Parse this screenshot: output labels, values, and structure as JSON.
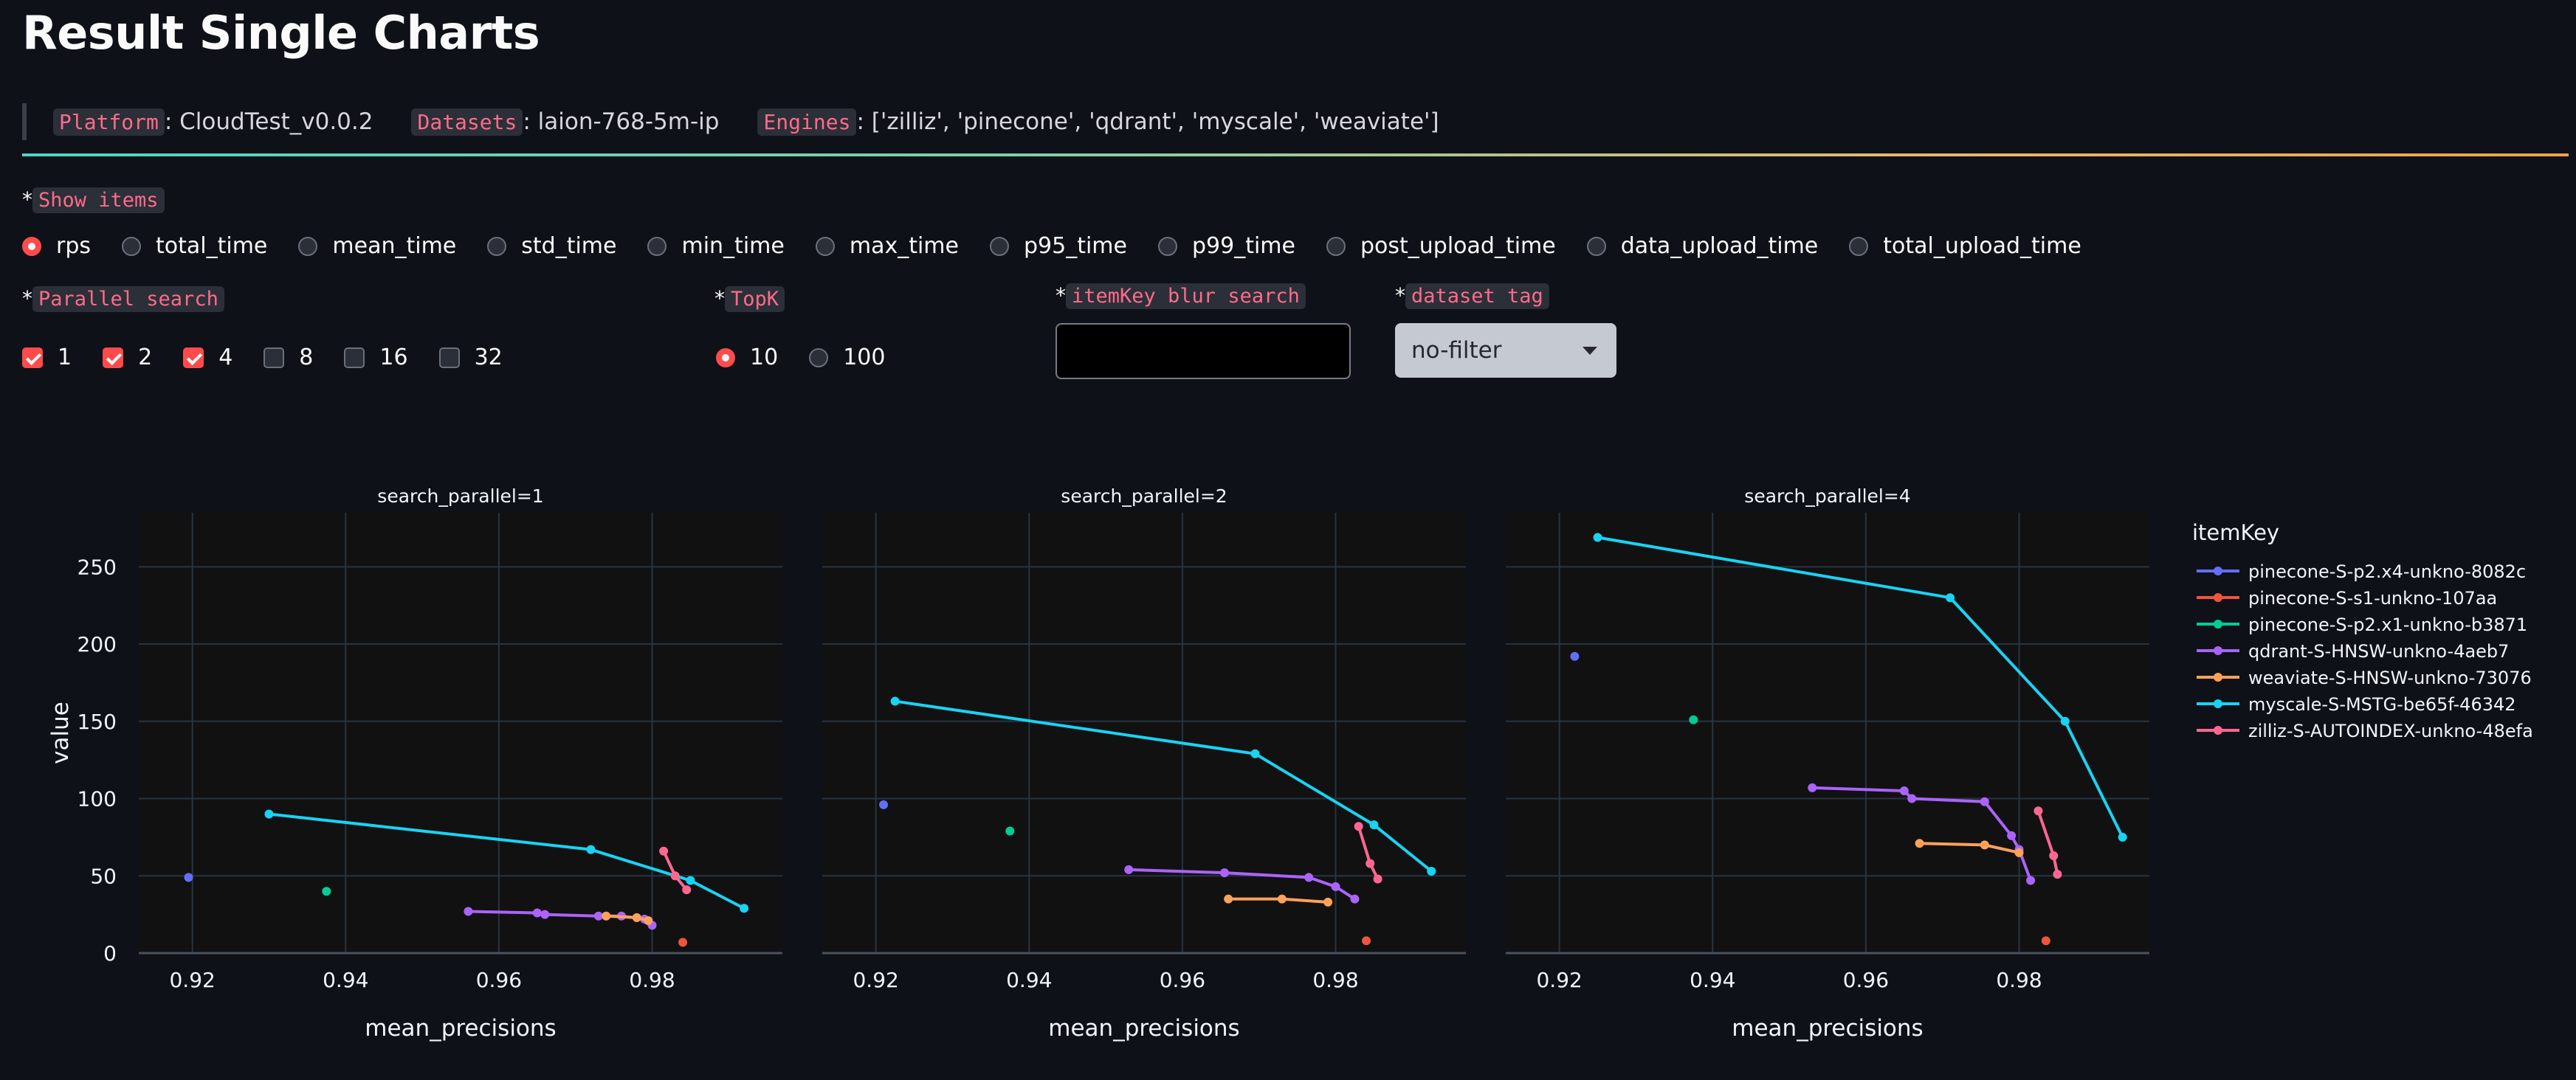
{
  "page": {
    "title": "Result Single Charts"
  },
  "info": {
    "platform_key": "Platform",
    "platform_value": ": CloudTest_v0.0.2",
    "datasets_key": "Datasets",
    "datasets_value": ": laion-768-5m-ip",
    "engines_key": "Engines",
    "engines_value": ": ['zilliz', 'pinecone', 'qdrant', 'myscale', 'weaviate']"
  },
  "show_items": {
    "label": "Show items",
    "options": [
      "rps",
      "total_time",
      "mean_time",
      "std_time",
      "min_time",
      "max_time",
      "p95_time",
      "p99_time",
      "post_upload_time",
      "data_upload_time",
      "total_upload_time"
    ],
    "selected": "rps"
  },
  "parallel_search": {
    "label": "Parallel search",
    "options": [
      {
        "label": "1",
        "checked": true
      },
      {
        "label": "2",
        "checked": true
      },
      {
        "label": "4",
        "checked": true
      },
      {
        "label": "8",
        "checked": false
      },
      {
        "label": "16",
        "checked": false
      },
      {
        "label": "32",
        "checked": false
      }
    ]
  },
  "topk": {
    "label": "TopK",
    "options": [
      "10",
      "100"
    ],
    "selected": "10"
  },
  "itemkey_search": {
    "label": "itemKey blur search",
    "value": ""
  },
  "dataset_tag": {
    "label": "dataset tag",
    "selected": "no-filter"
  },
  "colors": {
    "plot_bg": "#111111",
    "grid": "#283442",
    "series": [
      "#636efa",
      "#ef553b",
      "#00cc96",
      "#ab63fa",
      "#ffa15a",
      "#19d3f3",
      "#ff6692"
    ]
  },
  "chart_data": {
    "type": "line",
    "xlabel": "mean_precisions",
    "ylabel": "value",
    "xlim": [
      0.913,
      0.997
    ],
    "ylim": [
      0,
      285
    ],
    "xticks": [
      "0.92",
      "0.94",
      "0.96",
      "0.98"
    ],
    "yticks": [
      "0",
      "50",
      "100",
      "150",
      "200",
      "250"
    ],
    "legend_title": "itemKey",
    "legend_position": "right",
    "grid": true,
    "facets": [
      {
        "title": "search_parallel=1",
        "series": [
          {
            "name": "pinecone-S-p2.x4-unkno-8082c",
            "points": [
              [
                0.9195,
                49
              ]
            ]
          },
          {
            "name": "pinecone-S-s1-unkno-107aa",
            "points": [
              [
                0.984,
                7
              ]
            ]
          },
          {
            "name": "pinecone-S-p2.x1-unkno-b3871",
            "points": [
              [
                0.9375,
                40
              ]
            ]
          },
          {
            "name": "qdrant-S-HNSW-unkno-4aeb7",
            "points": [
              [
                0.956,
                27
              ],
              [
                0.965,
                26
              ],
              [
                0.966,
                25
              ],
              [
                0.973,
                24
              ],
              [
                0.976,
                24
              ],
              [
                0.979,
                22
              ],
              [
                0.98,
                18
              ]
            ]
          },
          {
            "name": "weaviate-S-HNSW-unkno-73076",
            "points": [
              [
                0.974,
                24
              ],
              [
                0.978,
                23
              ],
              [
                0.9795,
                21
              ]
            ]
          },
          {
            "name": "myscale-S-MSTG-be65f-46342",
            "points": [
              [
                0.93,
                90
              ],
              [
                0.972,
                67
              ],
              [
                0.985,
                47
              ],
              [
                0.992,
                29
              ]
            ]
          },
          {
            "name": "zilliz-S-AUTOINDEX-unkno-48efa",
            "points": [
              [
                0.9815,
                66
              ],
              [
                0.983,
                50
              ],
              [
                0.9845,
                41
              ]
            ]
          }
        ]
      },
      {
        "title": "search_parallel=2",
        "series": [
          {
            "name": "pinecone-S-p2.x4-unkno-8082c",
            "points": [
              [
                0.921,
                96
              ]
            ]
          },
          {
            "name": "pinecone-S-s1-unkno-107aa",
            "points": [
              [
                0.984,
                8
              ]
            ]
          },
          {
            "name": "pinecone-S-p2.x1-unkno-b3871",
            "points": [
              [
                0.9375,
                79
              ]
            ]
          },
          {
            "name": "qdrant-S-HNSW-unkno-4aeb7",
            "points": [
              [
                0.953,
                54
              ],
              [
                0.9655,
                52
              ],
              [
                0.9765,
                49
              ],
              [
                0.98,
                43
              ],
              [
                0.9825,
                35
              ]
            ]
          },
          {
            "name": "weaviate-S-HNSW-unkno-73076",
            "points": [
              [
                0.966,
                35
              ],
              [
                0.973,
                35
              ],
              [
                0.979,
                33
              ]
            ]
          },
          {
            "name": "myscale-S-MSTG-be65f-46342",
            "points": [
              [
                0.9225,
                163
              ],
              [
                0.9695,
                129
              ],
              [
                0.985,
                83
              ],
              [
                0.9925,
                53
              ]
            ]
          },
          {
            "name": "zilliz-S-AUTOINDEX-unkno-48efa",
            "points": [
              [
                0.983,
                82
              ],
              [
                0.9845,
                58
              ],
              [
                0.9855,
                48
              ]
            ]
          }
        ]
      },
      {
        "title": "search_parallel=4",
        "series": [
          {
            "name": "pinecone-S-p2.x4-unkno-8082c",
            "points": [
              [
                0.922,
                192
              ]
            ]
          },
          {
            "name": "pinecone-S-s1-unkno-107aa",
            "points": [
              [
                0.9835,
                8
              ]
            ]
          },
          {
            "name": "pinecone-S-p2.x1-unkno-b3871",
            "points": [
              [
                0.9375,
                151
              ]
            ]
          },
          {
            "name": "qdrant-S-HNSW-unkno-4aeb7",
            "points": [
              [
                0.953,
                107
              ],
              [
                0.965,
                105
              ],
              [
                0.966,
                100
              ],
              [
                0.9755,
                98
              ],
              [
                0.979,
                76
              ],
              [
                0.98,
                67
              ],
              [
                0.9815,
                47
              ]
            ]
          },
          {
            "name": "weaviate-S-HNSW-unkno-73076",
            "points": [
              [
                0.967,
                71
              ],
              [
                0.9755,
                70
              ],
              [
                0.98,
                65
              ]
            ]
          },
          {
            "name": "myscale-S-MSTG-be65f-46342",
            "points": [
              [
                0.925,
                269
              ],
              [
                0.971,
                230
              ],
              [
                0.986,
                150
              ],
              [
                0.9935,
                75
              ]
            ]
          },
          {
            "name": "zilliz-S-AUTOINDEX-unkno-48efa",
            "points": [
              [
                0.9825,
                92
              ],
              [
                0.9845,
                63
              ],
              [
                0.985,
                51
              ]
            ]
          }
        ]
      }
    ]
  }
}
